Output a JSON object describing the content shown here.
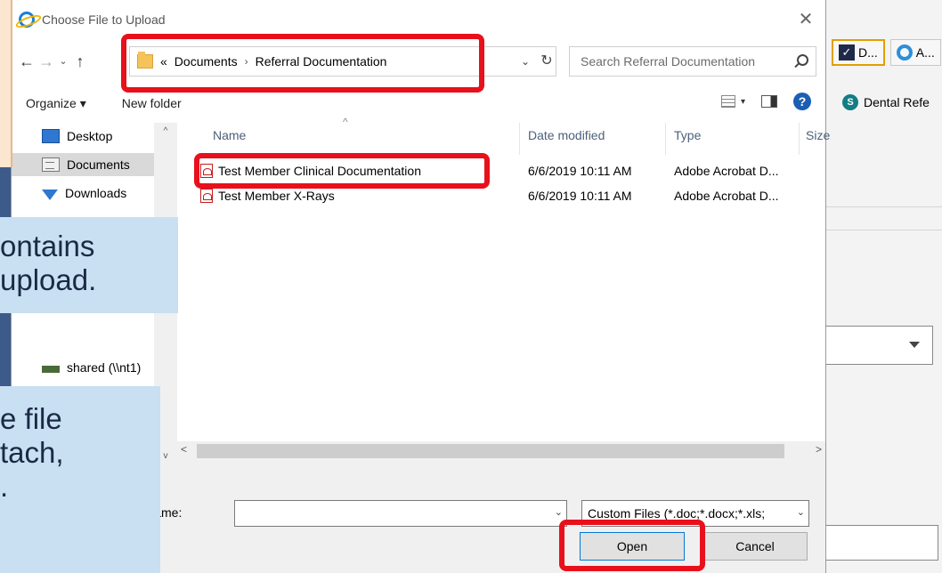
{
  "dialog": {
    "title": "Choose File to Upload",
    "close_glyph": "✕"
  },
  "nav_buttons": {
    "back": "←",
    "forward": "→",
    "recent": "⌄",
    "up": "↑"
  },
  "address": {
    "overflow": "«",
    "crumbs": [
      "Documents",
      "Referral Documentation"
    ],
    "separator": "›",
    "dropdown_glyph": "⌄",
    "refresh_glyph": "↻"
  },
  "search": {
    "placeholder": "Search Referral Documentation"
  },
  "toolbar": {
    "organize": "Organize ▾",
    "new_folder": "New folder",
    "view_caret": "▾",
    "help": "?"
  },
  "nav_pane": {
    "items": [
      {
        "label": "Desktop",
        "icon": "desktop-icon"
      },
      {
        "label": "Documents",
        "icon": "documents-icon",
        "selected": true
      },
      {
        "label": "Downloads",
        "icon": "downloads-icon"
      },
      {
        "label": "shared (\\\\nt1)",
        "icon": "network-drive-icon"
      }
    ]
  },
  "columns": {
    "name": "Name",
    "date": "Date modified",
    "type": "Type",
    "size": "Size"
  },
  "files": [
    {
      "name": "Test Member Clinical Documentation",
      "date": "6/6/2019 10:11 AM",
      "type": "Adobe Acrobat D..."
    },
    {
      "name": "Test Member X-Rays",
      "date": "6/6/2019 10:11 AM",
      "type": "Adobe Acrobat D..."
    }
  ],
  "bottom": {
    "file_name_label": "File name:",
    "file_name_value": "",
    "filter": "Custom Files (*.doc;*.docx;*.xls;",
    "open": "Open",
    "cancel": "Cancel"
  },
  "background": {
    "tab1": "D...",
    "tab2": "A...",
    "favorite": "Dental Refe"
  },
  "callouts": {
    "a": [
      "ontains",
      " upload."
    ],
    "b": [
      "e file",
      "tach,",
      "."
    ]
  },
  "colors": {
    "highlight": "#e8101b",
    "callout_bg": "#c9dff2",
    "accent": "#0078d7"
  }
}
